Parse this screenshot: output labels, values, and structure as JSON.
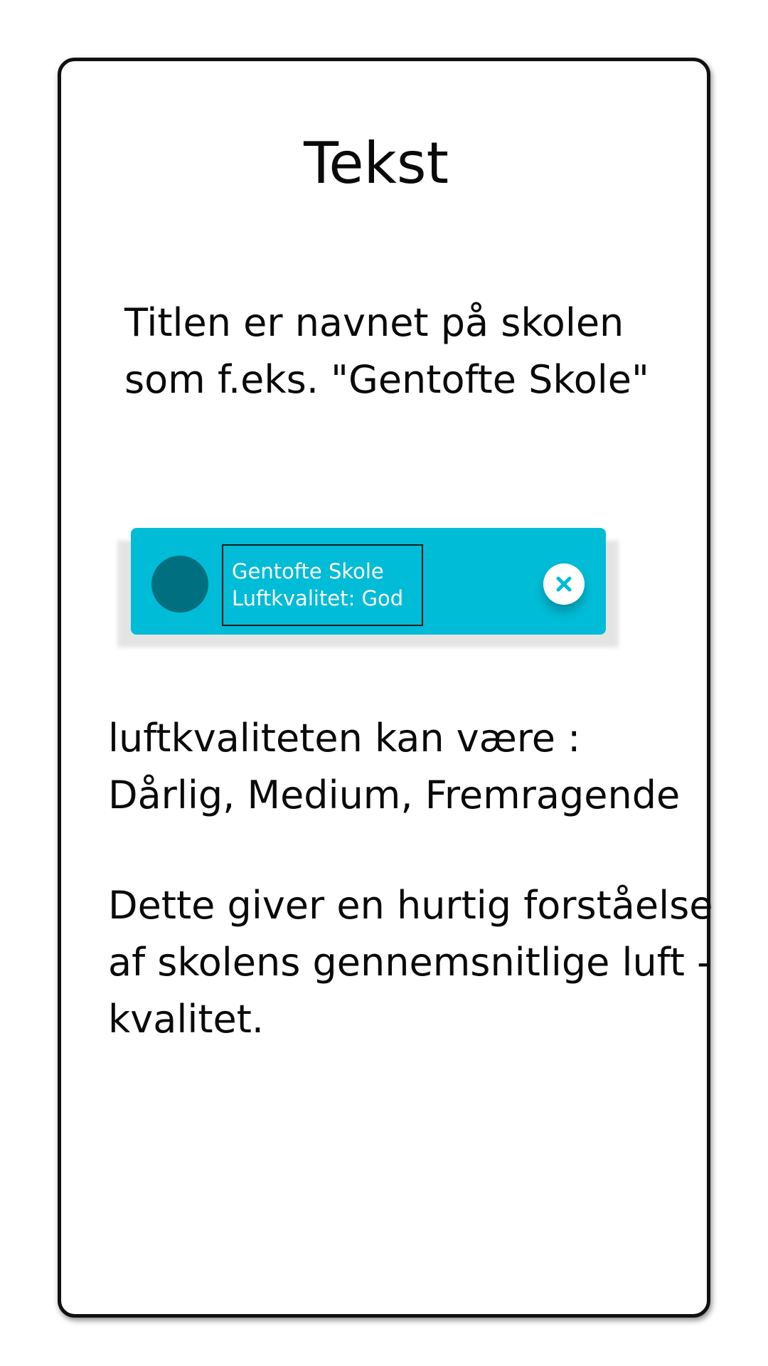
{
  "page": {
    "title": "Tekst",
    "intro": {
      "lines": [
        "Titlen er navnet på skolen",
        "som f.eks. \"Gentofte Skole\""
      ]
    },
    "quality": {
      "lines": [
        "luftkvaliteten kan være :",
        "Dårlig, Medium, Fremragende"
      ]
    },
    "explain": {
      "lines": [
        "Dette giver en hurtig forståelse",
        "af skolens gennemsnitlige luft -",
        "kvalitet."
      ]
    }
  },
  "card": {
    "school_name": "Gentofte Skole",
    "air_quality": "Luftkvalitet: God",
    "colors": {
      "card": "#00bcd6",
      "avatar": "#006f80",
      "close_icon": "#00bcd6"
    },
    "close_icon": "close-icon"
  }
}
